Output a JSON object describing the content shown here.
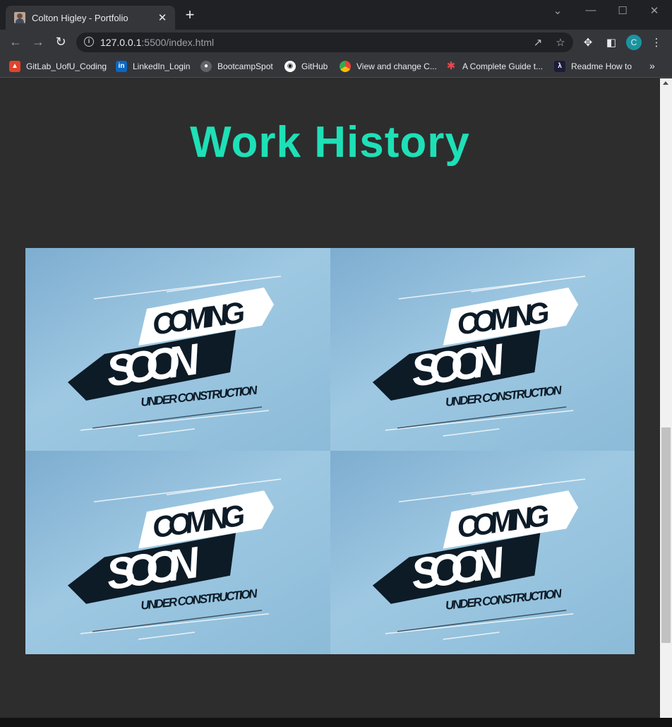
{
  "browser": {
    "tab_title": "Colton Higley - Portfolio",
    "tab_close": "✕",
    "new_tab": "+",
    "url_host": "127.0.0.1",
    "url_rest": ":5500/index.html",
    "profile_initial": "C",
    "bookmarks": [
      {
        "label": "GitLab_UofU_Coding",
        "icon": "gitlab-icon",
        "color": "#e2432a"
      },
      {
        "label": "LinkedIn_Login",
        "icon": "linkedin-icon",
        "color": "#0a66c2"
      },
      {
        "label": "BootcampSpot",
        "icon": "globe-icon",
        "color": "#9aa0a6"
      },
      {
        "label": "GitHub",
        "icon": "github-icon",
        "color": "#ffffff"
      },
      {
        "label": "View and change C...",
        "icon": "chrome-icon",
        "color": "#4285f4"
      },
      {
        "label": "A Complete Guide t...",
        "icon": "asterisk-icon",
        "color": "#e5484d"
      },
      {
        "label": "Readme How to",
        "icon": "dev-icon",
        "color": "#1c1c3a"
      }
    ]
  },
  "page": {
    "heading": "Work History",
    "heading_color": "#1ee0b7",
    "background_color": "#2d2d2d",
    "cards": [
      {
        "line1": "COMING",
        "line2": "SOON",
        "line3": "UNDER CONSTRUCTION"
      },
      {
        "line1": "COMING",
        "line2": "SOON",
        "line3": "UNDER CONSTRUCTION"
      },
      {
        "line1": "COMING",
        "line2": "SOON",
        "line3": "UNDER CONSTRUCTION"
      },
      {
        "line1": "COMING",
        "line2": "SOON",
        "line3": "UNDER CONSTRUCTION"
      }
    ]
  }
}
